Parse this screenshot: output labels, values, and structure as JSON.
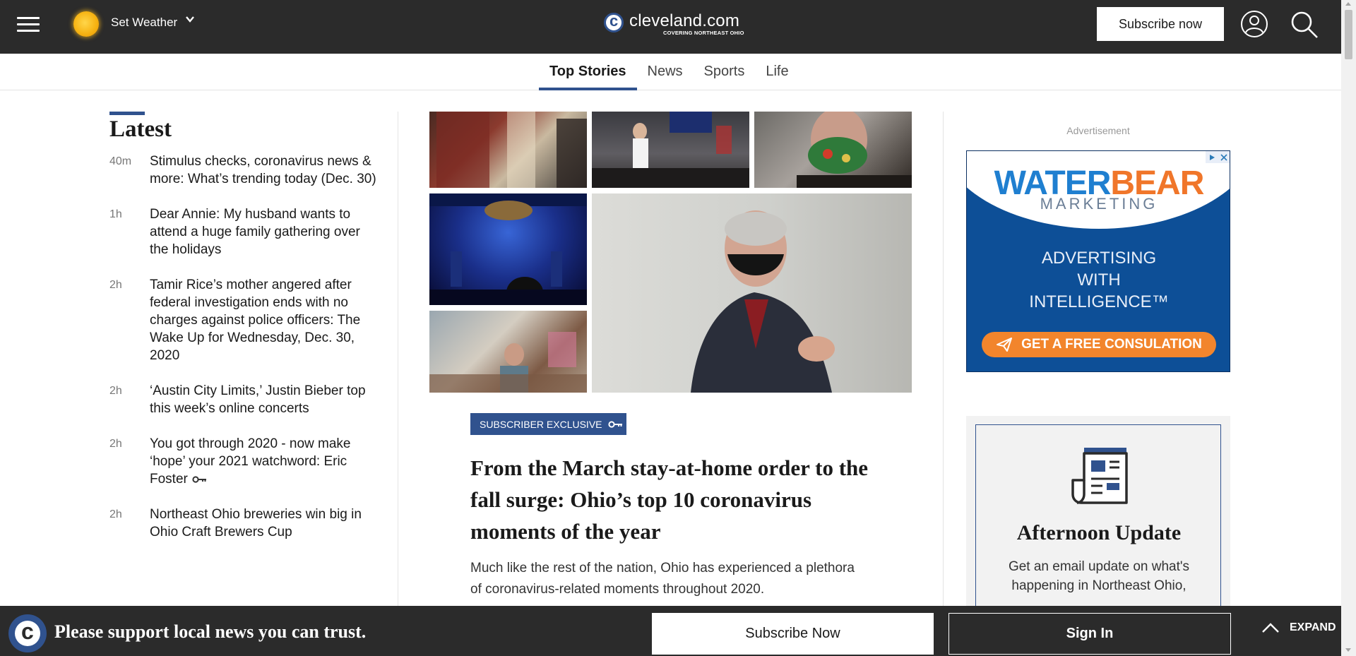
{
  "header": {
    "weather_label": "Set Weather",
    "logo_text": "cleveland.com",
    "logo_tagline": "COVERING NORTHEAST OHIO",
    "subscribe_label": "Subscribe now"
  },
  "nav": {
    "tabs": [
      {
        "label": "Top Stories",
        "active": true
      },
      {
        "label": "News",
        "active": false
      },
      {
        "label": "Sports",
        "active": false
      },
      {
        "label": "Life",
        "active": false
      }
    ]
  },
  "latest": {
    "title": "Latest",
    "items": [
      {
        "time": "40m",
        "headline": "Stimulus checks, coronavirus news & more: What’s trending today (Dec. 30)",
        "subscriber": false
      },
      {
        "time": "1h",
        "headline": "Dear Annie: My husband wants to attend a huge family gathering over the holidays",
        "subscriber": false
      },
      {
        "time": "2h",
        "headline": "Tamir Rice’s mother angered after federal investigation ends with no charges against police officers: The Wake Up for Wednesday, Dec. 30, 2020",
        "subscriber": false
      },
      {
        "time": "2h",
        "headline": "‘Austin City Limits,’ Justin Bieber top this week’s online concerts",
        "subscriber": false
      },
      {
        "time": "2h",
        "headline": "You got through 2020 - now make ‘hope’ your 2021 watchword: Eric Foster",
        "subscriber": true
      },
      {
        "time": "2h",
        "headline": "Northeast Ohio breweries win big in Ohio Craft Brewers Cup",
        "subscriber": false
      }
    ]
  },
  "feature": {
    "badge": "SUBSCRIBER EXCLUSIVE",
    "headline": "From the March stay-at-home order to the fall surge: Ohio’s top 10 coronavirus moments of the year",
    "dek": "Much like the rest of the nation, Ohio has experienced a plethora of coronavirus-related moments throughout 2020."
  },
  "ad": {
    "label": "Advertisement",
    "brand_a": "WATER",
    "brand_b": "BEAR",
    "sub": "MARKETING",
    "line1": "ADVERTISING",
    "line2": "WITH",
    "line3": "INTELLIGENCE™",
    "cta": "GET A FREE CONSULATION"
  },
  "newsletter": {
    "title": "Afternoon Update",
    "text": "Get an email update on what's happening in Northeast Ohio,"
  },
  "bottom": {
    "message": "Please support local news you can trust.",
    "subscribe_label": "Subscribe Now",
    "signin_label": "Sign In",
    "expand_label": "EXPAND"
  },
  "colors": {
    "header_bg": "#2b2b2b",
    "accent": "#30528e",
    "ad_blue": "#0d4f97",
    "ad_orange": "#f2852c"
  }
}
